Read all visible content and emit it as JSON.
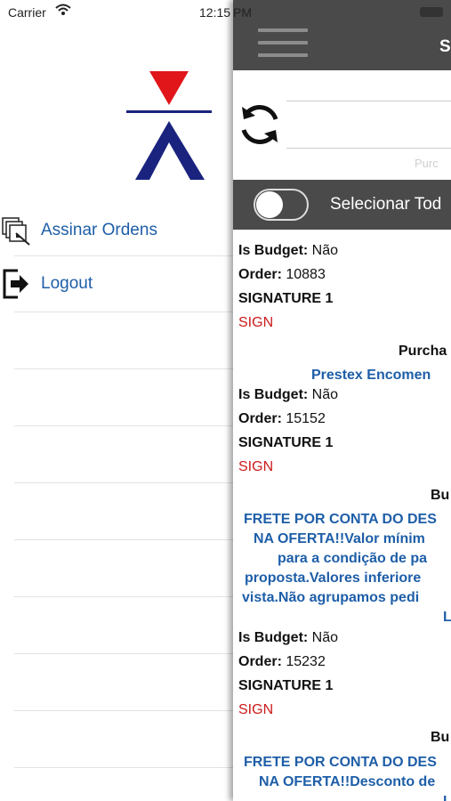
{
  "status_bar": {
    "carrier": "Carrier",
    "time_left": "12:15",
    "time_right": "PM"
  },
  "drawer": {
    "menu": [
      {
        "label": "Assinar Ordens",
        "icon": "stack-edit-icon"
      },
      {
        "label": "Logout",
        "icon": "logout-icon"
      }
    ]
  },
  "panel": {
    "title": "S",
    "search_placeholder_peek": "Purc",
    "select_all_label": "Selecionar Tod",
    "orders": [
      {
        "is_budget_label": "Is Budget:",
        "is_budget_value": "Não",
        "order_label": "Order:",
        "order_value": "10883",
        "signature": "SIGNATURE 1",
        "sign": "SIGN",
        "note_title": "Purcha",
        "note_lines": [
          "Prestex Encomen"
        ]
      },
      {
        "is_budget_label": "Is Budget:",
        "is_budget_value": "Não",
        "order_label": "Order:",
        "order_value": "15152",
        "signature": "SIGNATURE 1",
        "sign": "SIGN",
        "note_title": "Bu",
        "note_lines": [
          "FRETE POR CONTA DO DES",
          "NA OFERTA!!Valor mínim",
          "para a condição de pa",
          "proposta.Valores inferiore",
          "vista.Não agrupamos pedi",
          "Lt"
        ]
      },
      {
        "is_budget_label": "Is Budget:",
        "is_budget_value": "Não",
        "order_label": "Order:",
        "order_value": "15232",
        "signature": "SIGNATURE 1",
        "sign": "SIGN",
        "note_title": "Bu",
        "note_lines": [
          "FRETE POR CONTA DO DES",
          "NA OFERTA!!Desconto de",
          "Lt"
        ]
      }
    ]
  }
}
